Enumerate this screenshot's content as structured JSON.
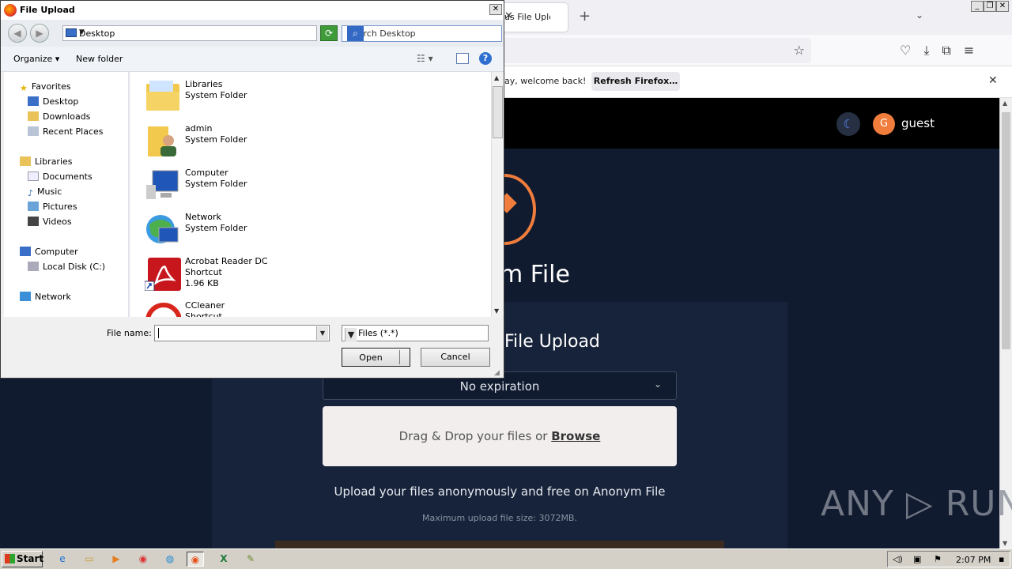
{
  "browser": {
    "tab_title": "us File Upload",
    "tab_close": "✕",
    "new_tab": "+",
    "tab_list": "⌄",
    "window_min": "_",
    "window_max": "❐",
    "window_close": "✕",
    "notification_message": "ay, welcome back!",
    "notification_button": "Refresh Firefox…",
    "notification_close": "✕"
  },
  "site": {
    "theme_toggle_icon": "☾",
    "avatar_letter": "G",
    "username": "guest",
    "brand_fragment": "m File",
    "heading_fragment": "File Upload",
    "expiration_selected": "No expiration",
    "drop_text": "Drag & Drop your files or ",
    "browse_link": "Browse",
    "tagline": "Upload your files anonymously and free on Anonym File",
    "max_size": "Maximum upload file size: 3072MB.",
    "watermark": "ANY ▷ RUN"
  },
  "dialog": {
    "title": "File Upload",
    "close": "✕",
    "address": "Desktop",
    "search_placeholder": "Search Desktop",
    "organize": "Organize ▾",
    "new_folder": "New folder",
    "help": "?",
    "nav": {
      "favorites": "Favorites",
      "desktop": "Desktop",
      "downloads": "Downloads",
      "recent_places": "Recent Places",
      "libraries": "Libraries",
      "documents": "Documents",
      "music": "Music",
      "pictures": "Pictures",
      "videos": "Videos",
      "computer": "Computer",
      "local_disk": "Local Disk (C:)",
      "network": "Network"
    },
    "files": [
      {
        "name": "Libraries",
        "type": "System Folder",
        "size": ""
      },
      {
        "name": "admin",
        "type": "System Folder",
        "size": ""
      },
      {
        "name": "Computer",
        "type": "System Folder",
        "size": ""
      },
      {
        "name": "Network",
        "type": "System Folder",
        "size": ""
      },
      {
        "name": "Acrobat Reader DC",
        "type": "Shortcut",
        "size": "1.96 KB"
      },
      {
        "name": "CCleaner",
        "type": "Shortcut",
        "size": ""
      }
    ],
    "file_name_label": "File name:",
    "file_name_value": "",
    "file_type": "All Files (*.*)",
    "open": "Open",
    "cancel": "Cancel"
  },
  "taskbar": {
    "start": "Start",
    "clock": "2:07 PM"
  },
  "colors": {
    "accent_orange": "#f07d3c",
    "site_bg": "#111b30",
    "dialog_bg": "#f0f0f0"
  }
}
